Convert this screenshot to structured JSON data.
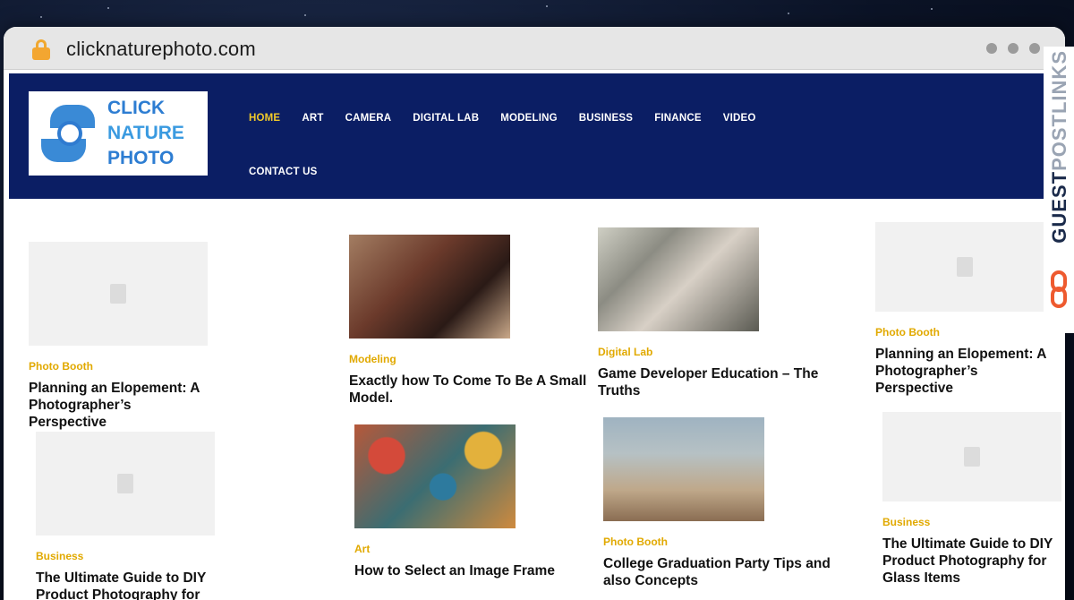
{
  "browser": {
    "url": "clicknaturephoto.com"
  },
  "logo": {
    "line1": "CLICK",
    "line2": "NATURE",
    "line3": "PHOTO"
  },
  "nav": {
    "items": [
      "HOME",
      "ART",
      "CAMERA",
      "DIGITAL LAB",
      "MODELING",
      "BUSINESS",
      "FINANCE",
      "VIDEO"
    ],
    "row2": "CONTACT US"
  },
  "posts": [
    {
      "category": "Photo Booth",
      "title": "Planning an Elopement: A Photographer’s Perspective",
      "image": "placeholder"
    },
    {
      "category": "Modeling",
      "title": "Exactly how To Come To Be A Small Model.",
      "image": "photo"
    },
    {
      "category": "Digital Lab",
      "title": "Game Developer Education – The Truths",
      "image": "photo"
    },
    {
      "category": "Photo Booth",
      "title": "Planning an Elopement: A Photographer’s Perspective",
      "image": "placeholder"
    },
    {
      "category": "Business",
      "title": "The Ultimate Guide to DIY Product Photography for Glass Items",
      "image": "placeholder"
    },
    {
      "category": "Art",
      "title": "How to Select an Image Frame",
      "image": "photo"
    },
    {
      "category": "Photo Booth",
      "title": "College Graduation Party Tips and also Concepts",
      "image": "photo"
    },
    {
      "category": "Business",
      "title": "The Ultimate Guide to DIY Product Photography for Glass Items",
      "image": "placeholder"
    }
  ],
  "badge": {
    "text_a": "GUEST",
    "text_b": "POSTLINKS"
  },
  "colors": {
    "header_bg": "#0b1e64",
    "nav_active": "#f0c92a",
    "category": "#e1a900",
    "lock": "#f3a631"
  }
}
